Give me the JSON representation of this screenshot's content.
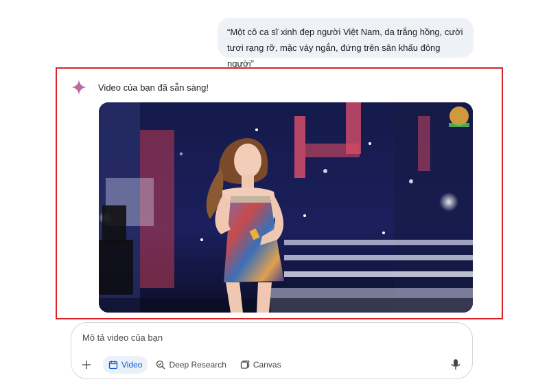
{
  "conversation": {
    "user_prompt": "“Một cô ca sĩ xinh đẹp người Việt Nam, da trắng hồng, cười tươi rạng rỡ, mặc váy ngắn, đứng trên sân khấu đông người”",
    "response_text": "Video của bạn đã sẵn sàng!"
  },
  "composer": {
    "placeholder": "Mô tả video của bạn",
    "tools": [
      {
        "label": "Video",
        "icon": "calendar-icon",
        "active": true
      },
      {
        "label": "Deep Research",
        "icon": "deep-research-icon",
        "active": false
      },
      {
        "label": "Canvas",
        "icon": "canvas-icon",
        "active": false
      }
    ]
  },
  "colors": {
    "highlight_border": "#d92228",
    "accent_blue": "#0b57d0",
    "user_bubble_bg": "#eef1f6",
    "gemini_star": "#c0475f"
  }
}
